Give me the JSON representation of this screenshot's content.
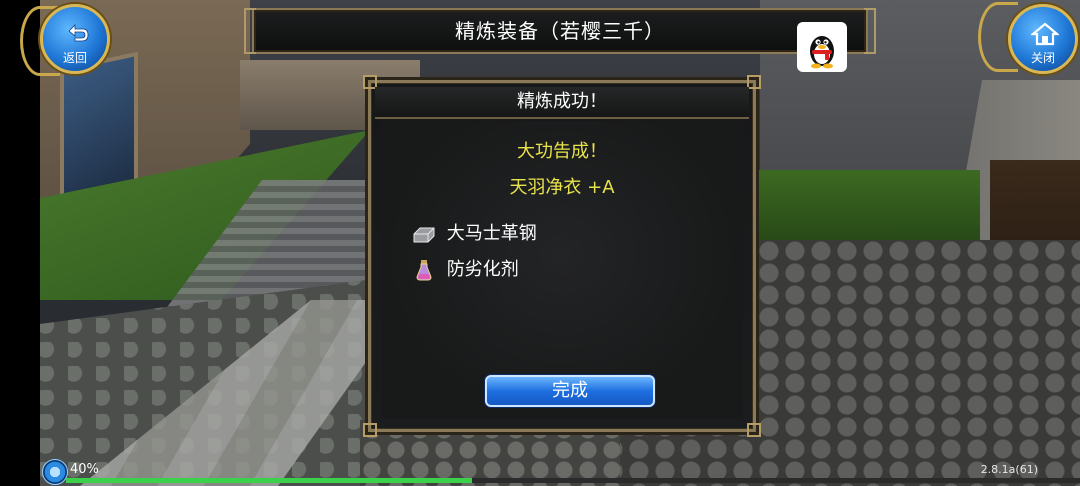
{
  "header": {
    "title": "精炼装备（若樱三千）",
    "back_label": "返回",
    "close_label": "关闭"
  },
  "dialog": {
    "title": "精炼成功！",
    "result": "大功告成！",
    "item": "天羽净衣 +A",
    "materials": [
      {
        "name": "大马士革钢",
        "icon": "steel-ingot-icon"
      },
      {
        "name": "防劣化剂",
        "icon": "potion-bottle-icon"
      }
    ],
    "confirm_label": "完成"
  },
  "status": {
    "progress_text": "40%",
    "progress_value": 0.4,
    "version": "2.8.1a(61)"
  },
  "colors": {
    "accent_gold": "#c9a84c",
    "result_yellow": "#e8e34a",
    "button_blue": "#1e6fe0",
    "progress_green": "#3bd14a"
  },
  "icons": {
    "back": "back-arrow-icon",
    "close": "home-icon",
    "qq": "qq-penguin-icon",
    "loading": "loading-orb-icon"
  }
}
